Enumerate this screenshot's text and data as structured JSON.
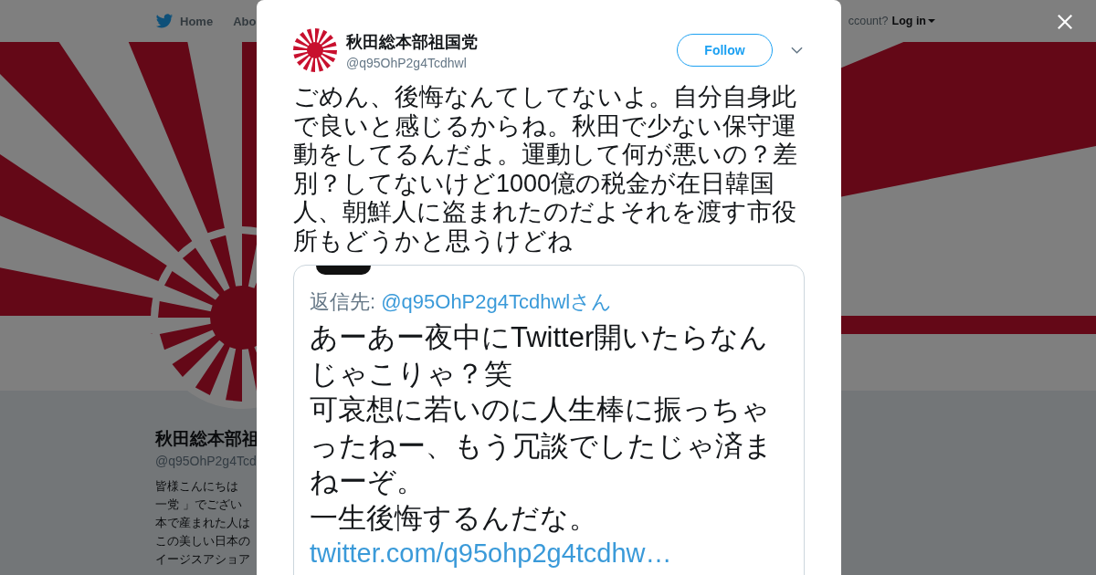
{
  "nav": {
    "items": [
      {
        "label": "Home",
        "kind": "home"
      },
      {
        "label": "Abo",
        "kind": "plain"
      }
    ],
    "account_prompt": "ccount?",
    "login": "Log in"
  },
  "profile": {
    "name": "秋田総本部祖",
    "handle": "@q95OhP2g4Tcd",
    "bio_lines": [
      "皆様こんにちは",
      "一党 」でござい",
      "本で産まれた人は",
      "この美しい日本の",
      "イージスアショア"
    ]
  },
  "tweet": {
    "name": "秋田総本部祖国党",
    "handle": "@q95OhP2g4Tcdhwl",
    "follow": "Follow",
    "text": "ごめん、後悔なんてしてないよ。自分自身此で良いと感じるからね。秋田で少ない保守運動をしてるんだよ。運動して何が悪いの？差別？してないけど1000億の税金が在日韓国人、朝鮮人に盗まれたのだよそれを渡す市役所もどうかと思うけどね",
    "image": {
      "reply_label": "返信先:",
      "reply_to": "@q95OhP2g4Tcdhwlさん",
      "lines": [
        "あーあー夜中にTwitter開いたらなん",
        "じゃこりゃ？笑",
        "可哀想に若いのに人生棒に振っちゃ",
        "ったねー、もう冗談でしたじゃ済ま",
        "ねーぞ。",
        "一生後悔するんだな。"
      ],
      "link": "twitter.com/q95ohp2g4tcdhw…"
    }
  }
}
